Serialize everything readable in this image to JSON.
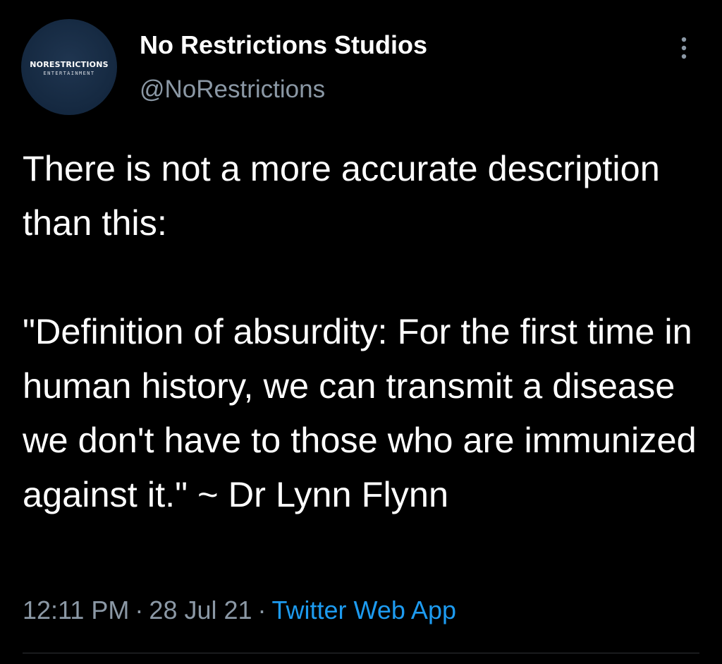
{
  "author": {
    "display_name": "No Restrictions Studios",
    "handle": "@NoRestrictions",
    "avatar_logo": {
      "main_text": "NORESTRICTIONS",
      "sub_text": "ENTERTAINMENT"
    }
  },
  "tweet": {
    "paragraph_1": "There is not a more accurate description than this:",
    "paragraph_2": "\"Definition of absurdity: For the first time in human history, we can transmit a disease we don't have to those who are immunized against it.\" ~ Dr Lynn Flynn"
  },
  "meta": {
    "time": "12:11 PM",
    "date": "28 Jul 21",
    "separator": "·",
    "source": "Twitter Web App"
  },
  "icons": {
    "more": "more-vertical-icon"
  },
  "colors": {
    "background": "#000000",
    "primary_text": "#ffffff",
    "secondary_text": "#8b98a5",
    "link": "#1d9bf0",
    "avatar": "#162a42"
  }
}
